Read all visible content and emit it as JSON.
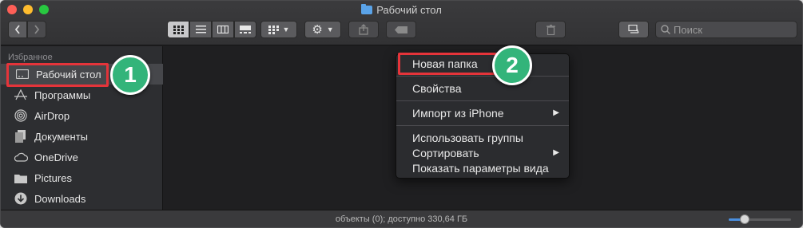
{
  "window": {
    "title": "Рабочий стол"
  },
  "toolbar": {
    "back_icon": "chevron-left-icon",
    "forward_icon": "chevron-right-icon",
    "view_modes": [
      "icon-view",
      "list-view",
      "column-view",
      "gallery-view"
    ],
    "search_placeholder": "Поиск"
  },
  "sidebar": {
    "heading": "Избранное",
    "items": [
      {
        "label": "Рабочий стол",
        "icon": "desktop-icon"
      },
      {
        "label": "Программы",
        "icon": "applications-icon"
      },
      {
        "label": "AirDrop",
        "icon": "airdrop-icon"
      },
      {
        "label": "Документы",
        "icon": "documents-icon"
      },
      {
        "label": "OneDrive",
        "icon": "cloud-icon"
      },
      {
        "label": "Pictures",
        "icon": "folder-icon"
      },
      {
        "label": "Downloads",
        "icon": "download-icon"
      }
    ]
  },
  "context_menu": {
    "items": [
      {
        "label": "Новая папка"
      },
      {
        "label": "Свойства"
      },
      {
        "label": "Импорт из iPhone"
      },
      {
        "label": "Использовать группы"
      },
      {
        "label": "Сортировать"
      },
      {
        "label": "Показать параметры вида"
      }
    ]
  },
  "annotations": {
    "badge1": "1",
    "badge2": "2",
    "highlight_color": "#e5343a",
    "badge_color": "#33b47a"
  },
  "status": {
    "text": "объекты (0); доступно 330,64 ГБ",
    "zoom_fraction": 0.25
  }
}
